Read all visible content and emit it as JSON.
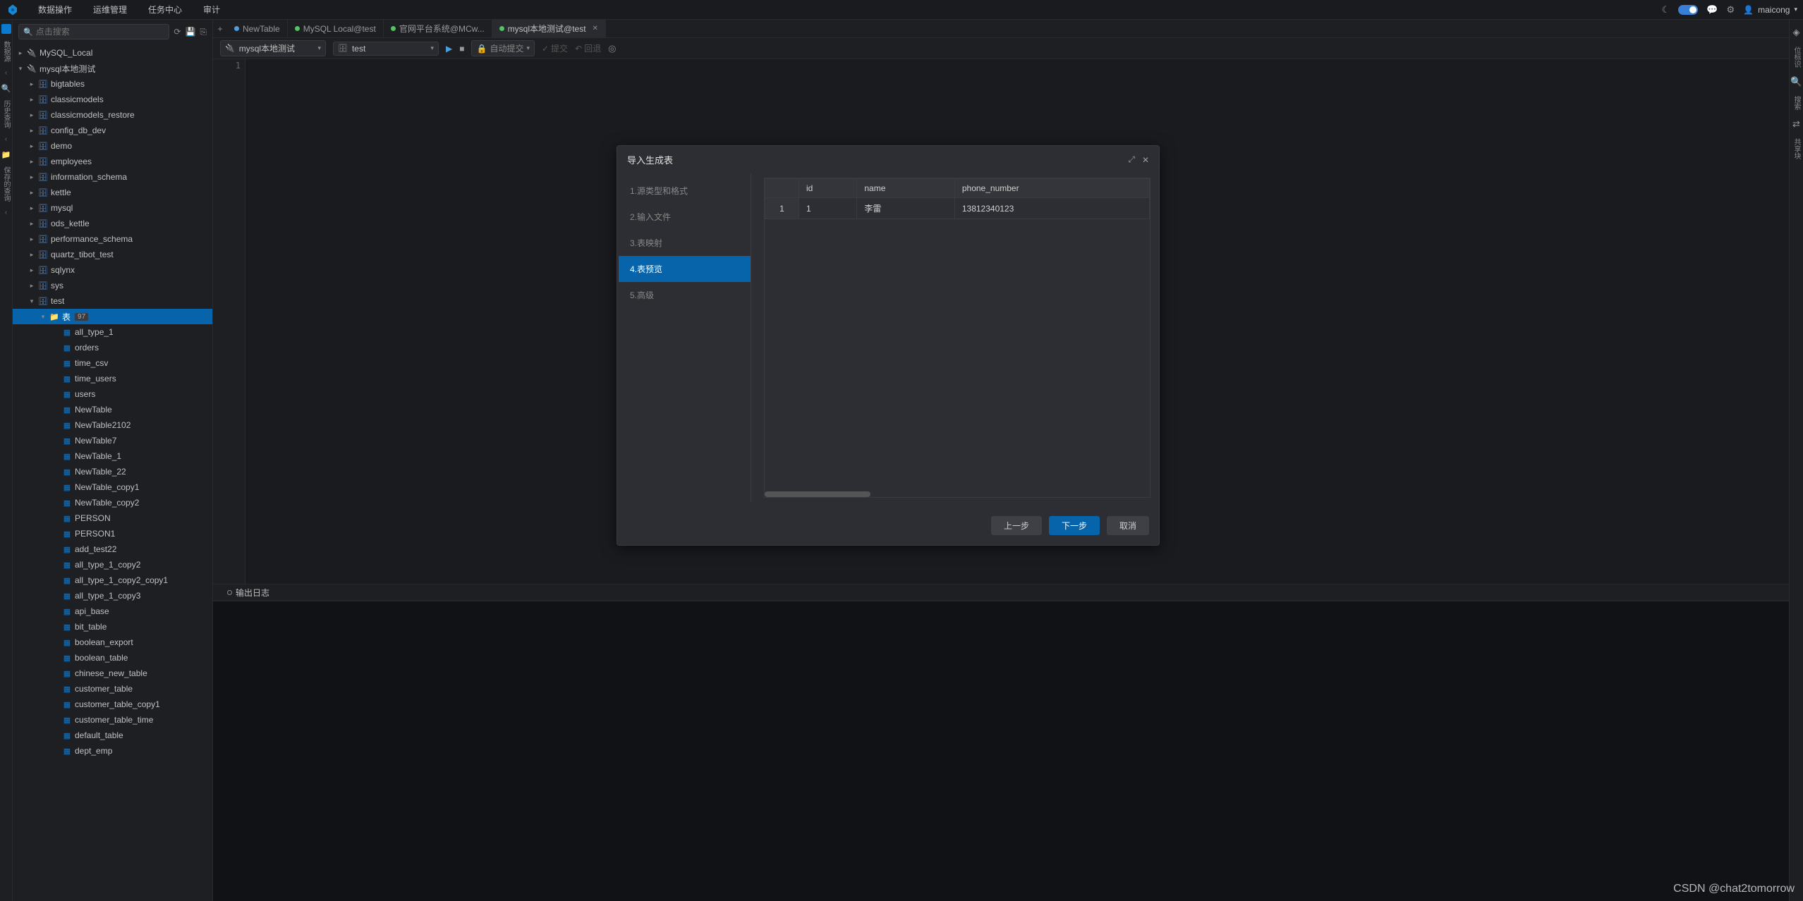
{
  "topnav": {
    "items": [
      "数据操作",
      "运维管理",
      "任务中心",
      "审计"
    ]
  },
  "user": {
    "name": "maicong"
  },
  "search": {
    "placeholder": "点击搜索"
  },
  "leftbar": {
    "labels": [
      "数据源",
      "历史查询",
      "保存的查询"
    ]
  },
  "tree": {
    "connections": [
      {
        "name": "MySQL_Local",
        "expanded": false
      },
      {
        "name": "mysql本地测试",
        "expanded": true,
        "databases": [
          {
            "name": "bigtables"
          },
          {
            "name": "classicmodels"
          },
          {
            "name": "classicmodels_restore"
          },
          {
            "name": "config_db_dev"
          },
          {
            "name": "demo"
          },
          {
            "name": "employees"
          },
          {
            "name": "information_schema"
          },
          {
            "name": "kettle"
          },
          {
            "name": "mysql"
          },
          {
            "name": "ods_kettle"
          },
          {
            "name": "performance_schema"
          },
          {
            "name": "quartz_tibot_test"
          },
          {
            "name": "sqlynx"
          },
          {
            "name": "sys"
          },
          {
            "name": "test",
            "expanded": true,
            "folders": [
              {
                "name": "表",
                "count": 97,
                "active": true,
                "tables": [
                  "all_type_1",
                  "orders",
                  "time_csv",
                  "time_users",
                  "users",
                  "NewTable",
                  "NewTable2102",
                  "NewTable7",
                  "NewTable_1",
                  "NewTable_22",
                  "NewTable_copy1",
                  "NewTable_copy2",
                  "PERSON",
                  "PERSON1",
                  "add_test22",
                  "all_type_1_copy2",
                  "all_type_1_copy2_copy1",
                  "all_type_1_copy3",
                  "api_base",
                  "bit_table",
                  "boolean_export",
                  "boolean_table",
                  "chinese_new_table",
                  "customer_table",
                  "customer_table_copy1",
                  "customer_table_time",
                  "default_table",
                  "dept_emp"
                ]
              }
            ]
          }
        ]
      }
    ]
  },
  "tabs": {
    "items": [
      {
        "label": "NewTable",
        "dot": "blue"
      },
      {
        "label": "MySQL Local@test",
        "dot": "green"
      },
      {
        "label": "官网平台系统@MCw...",
        "dot": "green"
      },
      {
        "label": "mysql本地测试@test",
        "dot": "green",
        "active": true,
        "closable": true
      }
    ]
  },
  "toolbar": {
    "conn": "mysql本地测试",
    "db": "test",
    "auto_commit": "自动提交",
    "commit": "提交",
    "rollback": "回退"
  },
  "editor": {
    "line": "1"
  },
  "output": {
    "tab": "输出日志"
  },
  "rightbar": {
    "items": [
      "位标识",
      "搜索",
      "共享块"
    ]
  },
  "modal": {
    "title": "导入生成表",
    "steps": [
      "1.源类型和格式",
      "2.输入文件",
      "3.表映射",
      "4.表预览",
      "5.高级"
    ],
    "active_step": 3,
    "preview": {
      "headers": [
        "id",
        "name",
        "phone_number"
      ],
      "rows": [
        {
          "n": "1",
          "cells": [
            "1",
            "李雷",
            "13812340123"
          ]
        }
      ]
    },
    "buttons": {
      "prev": "上一步",
      "next": "下一步",
      "cancel": "取消"
    }
  },
  "watermark": "CSDN @chat2tomorrow"
}
